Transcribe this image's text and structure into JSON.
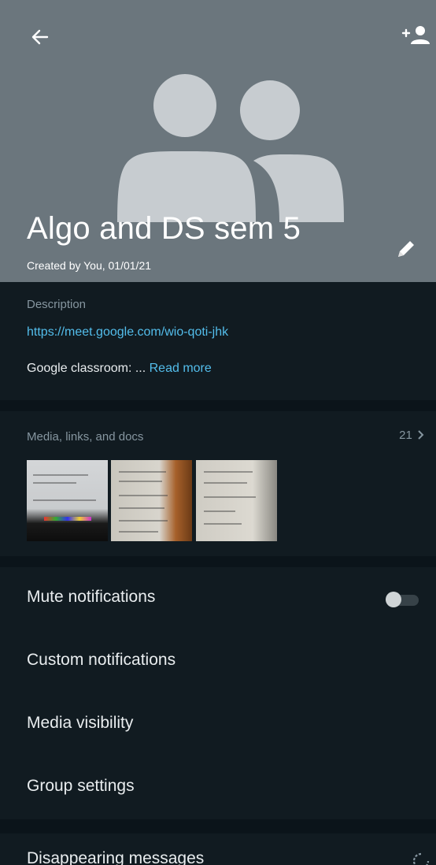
{
  "header": {
    "title": "Algo and DS sem 5",
    "created": "Created by You, 01/01/21",
    "back_icon": "arrow-left-icon",
    "add_icon": "person-add-icon",
    "edit_icon": "pencil-icon",
    "avatar_icon": "group-avatar-icon"
  },
  "description": {
    "label": "Description",
    "link": "https://meet.google.com/wio-qoti-jhk",
    "preview": "Google classroom: ... ",
    "read_more": "Read more"
  },
  "media": {
    "label": "Media, links, and docs",
    "count": "21",
    "chevron_icon": "chevron-right-icon"
  },
  "settings": {
    "mute": "Mute notifications",
    "mute_enabled": false,
    "custom": "Custom notifications",
    "visibility": "Media visibility",
    "group_settings": "Group settings"
  },
  "disappearing": {
    "label": "Disappearing messages",
    "icon": "timer-icon"
  },
  "colors": {
    "header_bg": "#6b767d",
    "panel_bg": "#111b21",
    "page_bg": "#0b141a",
    "link": "#53bdeb",
    "muted_text": "#8696a0"
  }
}
